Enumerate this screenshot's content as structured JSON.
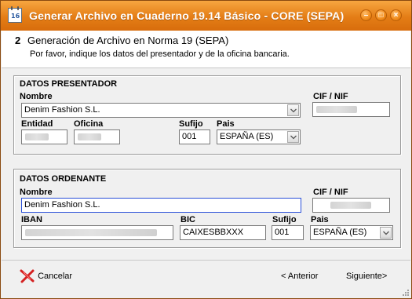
{
  "window": {
    "title": "Generar Archivo en Cuaderno 19.14 Básico - CORE (SEPA)",
    "icon": "calendar-16-icon",
    "buttons": [
      "minimize-icon",
      "maximize-icon",
      "close-icon"
    ]
  },
  "header": {
    "step": "2",
    "title": "Generación de Archivo en Norma 19 (SEPA)",
    "subtitle": "Por favor, indique los datos del presentador y de la oficina bancaria."
  },
  "presentador": {
    "section_title": "DATOS PRESENTADOR",
    "nombre_label": "Nombre",
    "nombre_value": "Denim Fashion S.L.",
    "cif_label": "CIF / NIF",
    "entidad_label": "Entidad",
    "oficina_label": "Oficina",
    "sufijo_label": "Sufijo",
    "sufijo_value": "001",
    "pais_label": "Pais",
    "pais_value": "ESPAÑA  (ES)"
  },
  "ordenante": {
    "section_title": "DATOS ORDENANTE",
    "nombre_label": "Nombre",
    "nombre_value": "Denim Fashion S.L.",
    "cif_label": "CIF / NIF",
    "iban_label": "IBAN",
    "bic_label": "BIC",
    "bic_value": "CAIXESBBXXX",
    "sufijo_label": "Sufijo",
    "sufijo_value": "001",
    "pais_label": "Pais",
    "pais_value": "ESPAÑA  (ES)"
  },
  "footer": {
    "cancel_label": "Cancelar",
    "back_label": "< Anterior",
    "next_label": "Siguiente>"
  },
  "colors": {
    "titlebar": "#e47d16",
    "focus_border": "#2a4fd8",
    "cancel_x": "#d42020"
  }
}
